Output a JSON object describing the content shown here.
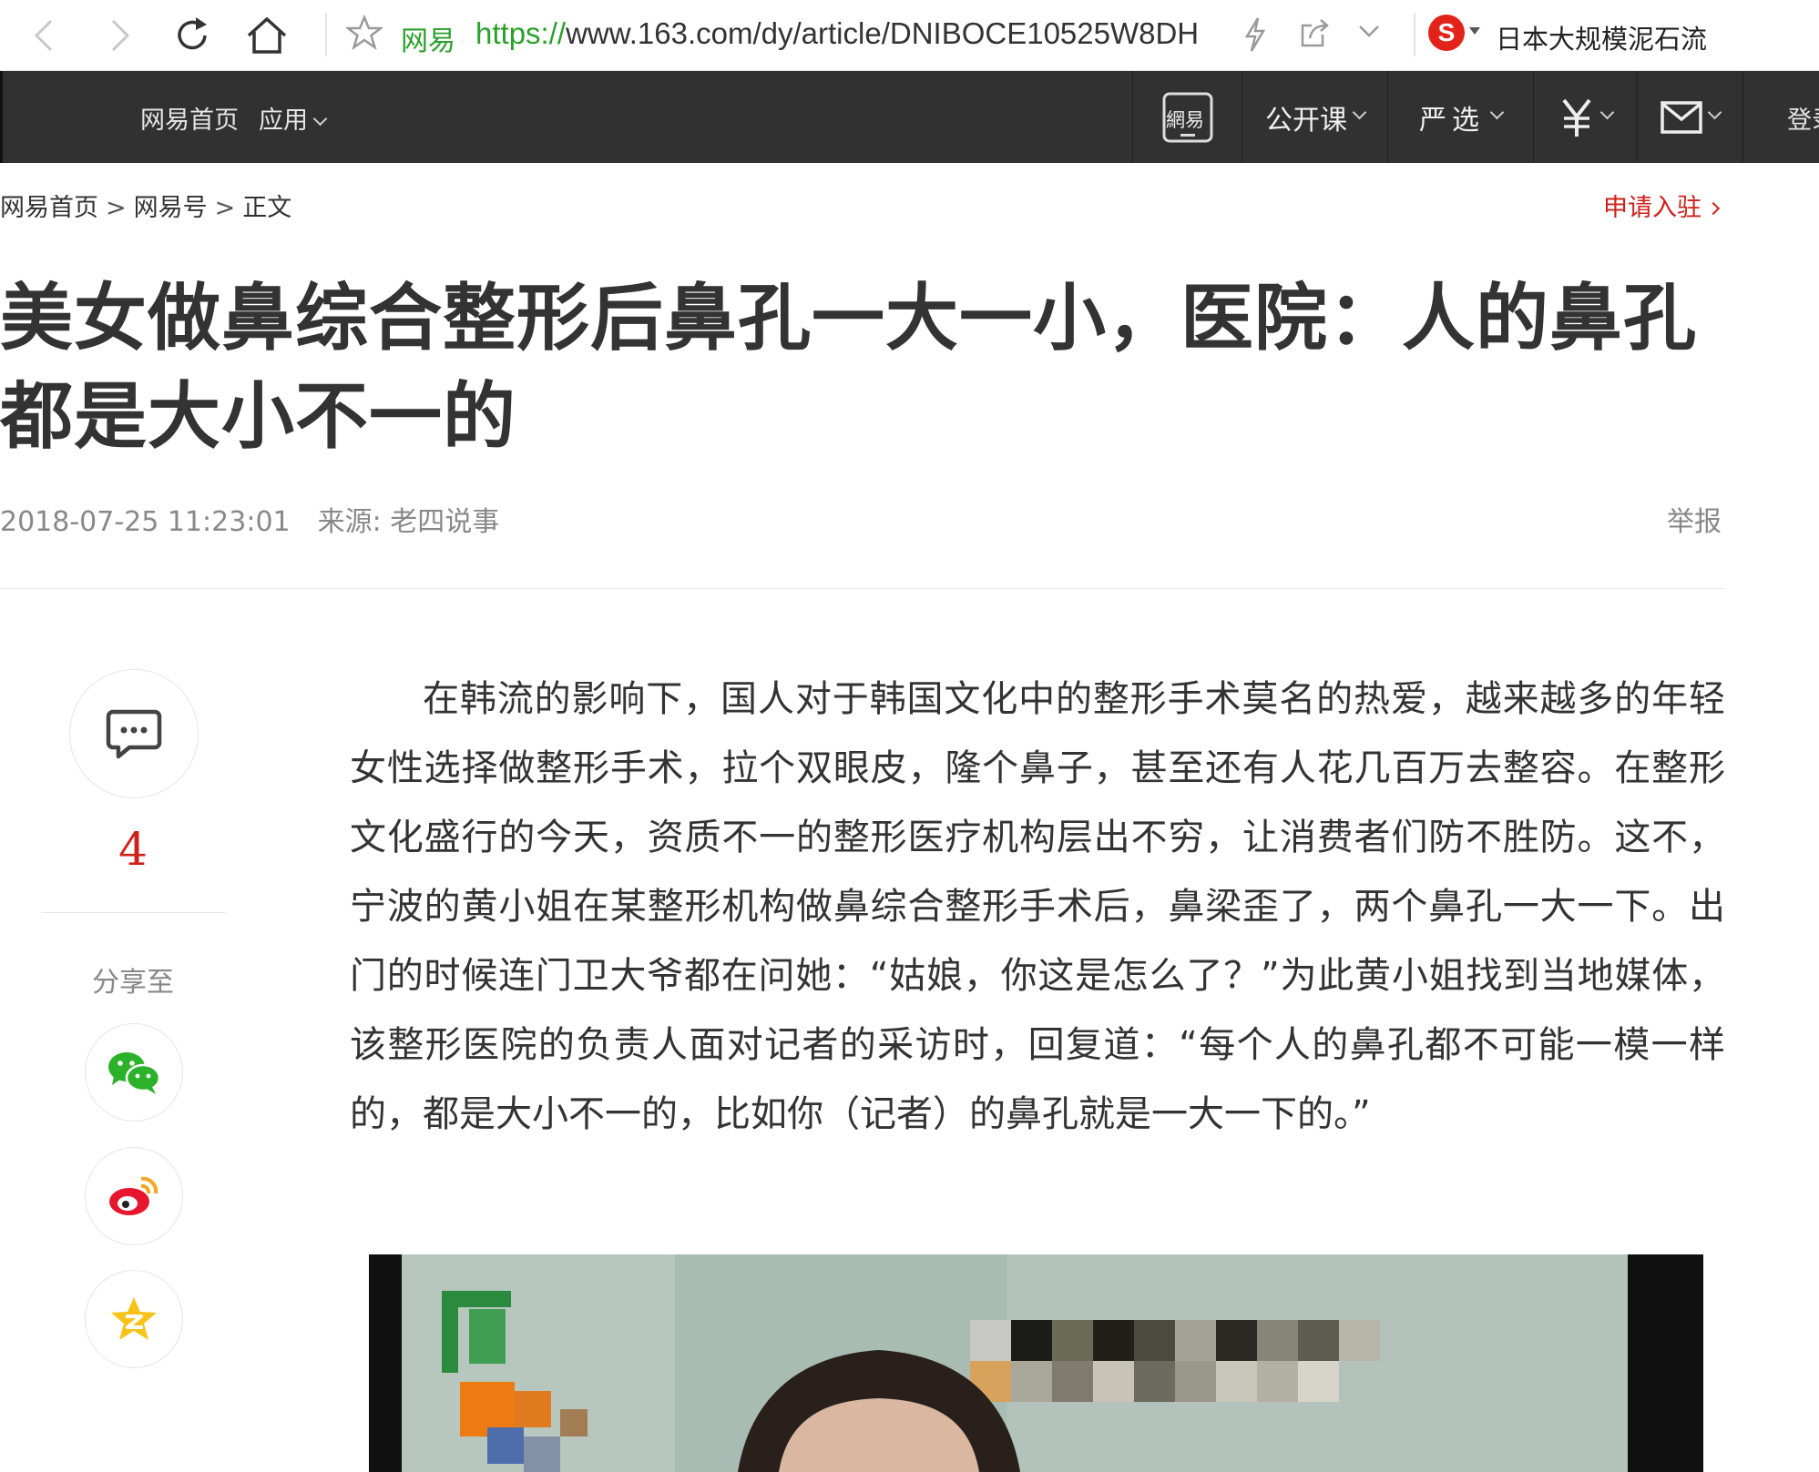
{
  "browser": {
    "site_label": "网易",
    "url_scheme": "https://",
    "url_rest": "www.163.com/dy/article/DNIBOCE10525W8DH",
    "search_text": "日本大规模泥石流"
  },
  "site_nav": {
    "home": "网易首页",
    "apps": "应用",
    "mobile": "網易",
    "open_course": "公开课",
    "yanxuan": "严选",
    "login": "登录"
  },
  "breadcrumb": [
    "网易首页",
    "网易号",
    "正文"
  ],
  "apply_link": "申请入驻",
  "article": {
    "title": "美女做鼻综合整形后鼻孔一大一小，医院：人的鼻孔都是大小不一的",
    "datetime": "2018-07-25 11:23:01",
    "source": "来源: 老四说事",
    "report": "举报",
    "comment_count": "4",
    "share_label": "分享至",
    "body": "在韩流的影响下，国人对于韩国文化中的整形手术莫名的热爱，越来越多的年轻女性选择做整形手术，拉个双眼皮，隆个鼻子，甚至还有人花几百万去整容。在整形文化盛行的今天，资质不一的整形医疗机构层出不穷，让消费者们防不胜防。这不，宁波的黄小姐在某整形机构做鼻综合整形手术后，鼻梁歪了，两个鼻孔一大一下。出门的时候连门卫大爷都在问她：“姑娘，你这是怎么了？”为此黄小姐找到当地媒体，该整形医院的负责人面对记者的采访时，回复道：“每个人的鼻孔都不可能一模一样的，都是大小不一的，比如你（记者）的鼻孔就是一大一下的。”"
  },
  "icons": {
    "back": "back-arrow-icon",
    "forward": "forward-arrow-icon",
    "reload": "reload-icon",
    "home": "home-icon",
    "bookmark": "star-icon",
    "comment": "comment-icon",
    "wechat": "wechat-icon",
    "weibo": "weibo-icon",
    "qzone": "qzone-icon"
  },
  "colors": {
    "accent_red": "#d0201a",
    "nav_bg": "#313131",
    "url_green": "#2aa12a"
  }
}
